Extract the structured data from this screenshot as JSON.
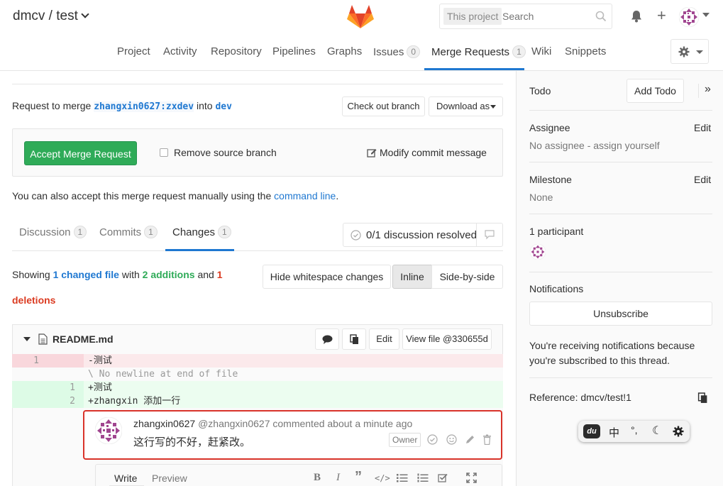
{
  "header": {
    "project_path": "dmcv / test",
    "search_scope": "This project",
    "search_placeholder": "Search"
  },
  "nav": {
    "tabs": [
      {
        "label": "Project"
      },
      {
        "label": "Activity"
      },
      {
        "label": "Repository"
      },
      {
        "label": "Pipelines"
      },
      {
        "label": "Graphs"
      },
      {
        "label": "Issues",
        "count": "0"
      },
      {
        "label": "Merge Requests",
        "count": "1",
        "active": true
      },
      {
        "label": "Wiki"
      },
      {
        "label": "Snippets"
      }
    ]
  },
  "merge_request": {
    "request_prefix": "Request to merge",
    "source_branch": "zhangxin0627:zxdev",
    "into": "into",
    "target_branch": "dev",
    "checkout_label": "Check out branch",
    "download_label": "Download as",
    "accept_label": "Accept Merge Request",
    "remove_source_label": "Remove source branch",
    "modify_commit_label": "Modify commit message",
    "manual_text": "You can also accept this merge request manually using the",
    "command_line_link": "command line",
    "manual_suffix": "."
  },
  "tabs": {
    "discussion": {
      "label": "Discussion",
      "count": "1"
    },
    "commits": {
      "label": "Commits",
      "count": "1"
    },
    "changes": {
      "label": "Changes",
      "count": "1"
    },
    "discussion_status": "0/1 discussion resolved"
  },
  "changes_summary": {
    "showing": "Showing",
    "changed_files": "1 changed file",
    "with": "with",
    "additions": "2 additions",
    "and": "and",
    "deletions_count": "1",
    "deletions_word": "deletions",
    "hide_whitespace": "Hide whitespace changes",
    "inline": "Inline",
    "side_by_side": "Side-by-side"
  },
  "file": {
    "name": "README.md",
    "edit_label": "Edit",
    "view_file_label": "View file @330655d"
  },
  "diff_lines": [
    {
      "old": "1",
      "new": "",
      "type": "deleted",
      "text": "-测试"
    },
    {
      "old": "",
      "new": "",
      "type": "meta",
      "text": "\\ No newline at end of file"
    },
    {
      "old": "",
      "new": "1",
      "type": "added",
      "text": "+测试"
    },
    {
      "old": "",
      "new": "2",
      "type": "added",
      "text": "+zhangxin 添加一行"
    }
  ],
  "comment": {
    "author": "zhangxin0627",
    "meta": "@zhangxin0627 commented about a minute ago",
    "body": "这行写的不好，赶紧改。",
    "role": "Owner"
  },
  "editor": {
    "write_tab": "Write",
    "preview_tab": "Preview"
  },
  "sidebar": {
    "todo_label": "Todo",
    "add_todo_label": "Add Todo",
    "assignee_title": "Assignee",
    "assignee_edit": "Edit",
    "assignee_value": "No assignee - assign yourself",
    "milestone_title": "Milestone",
    "milestone_edit": "Edit",
    "milestone_value": "None",
    "participants": "1 participant",
    "notifications_title": "Notifications",
    "unsubscribe_label": "Unsubscribe",
    "notification_note": "You're receiving notifications because you're subscribed to this thread.",
    "reference": "Reference: dmcv/test!1"
  },
  "ime": {
    "lang": "中",
    "punct": "°,"
  },
  "colors": {
    "accent": "#1f78d1",
    "accept_green": "#2fab58",
    "addition_green": "#2fab58",
    "deletion_red": "#db3b21",
    "highlight_red": "#d9332a",
    "added_bg": "#ecfdf0",
    "deleted_bg": "#fbe9eb"
  }
}
